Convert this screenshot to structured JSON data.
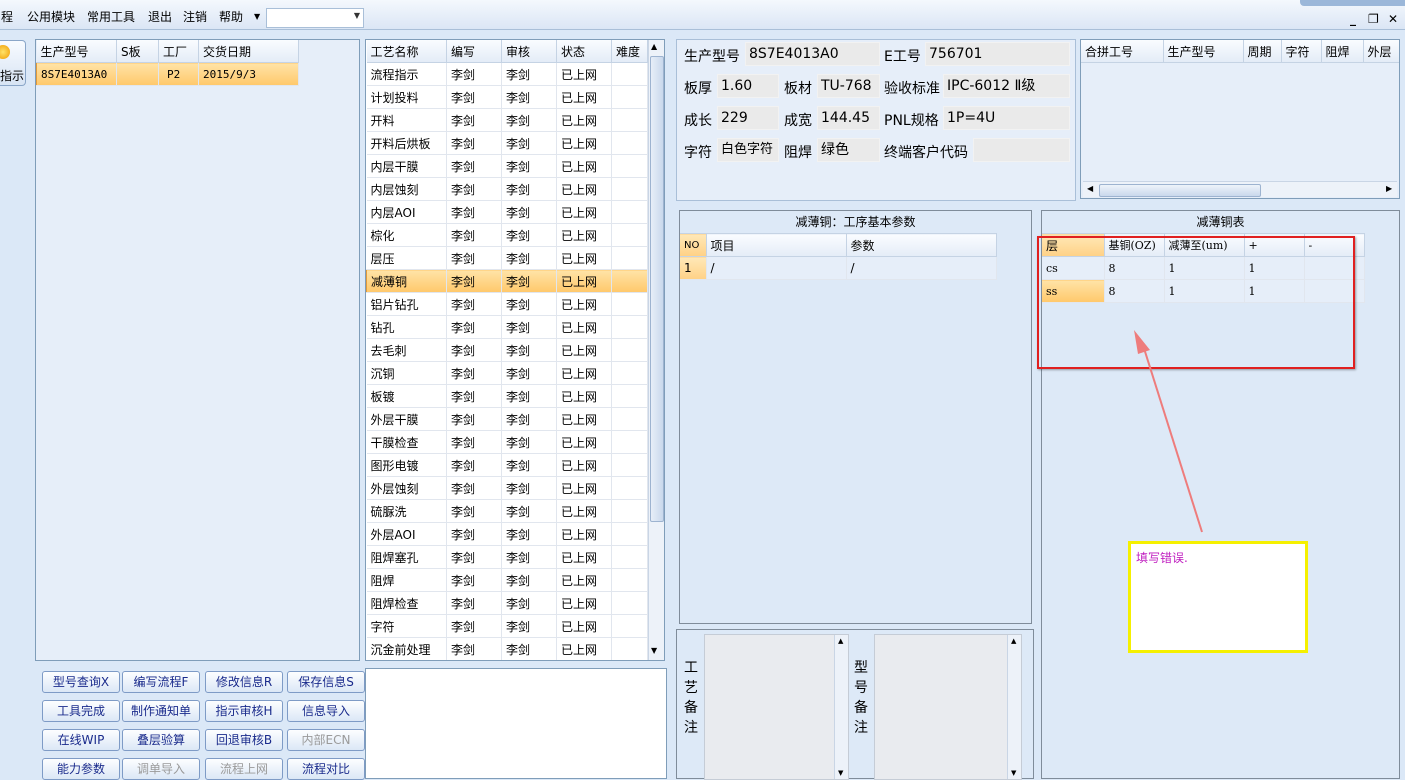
{
  "menu": {
    "items": [
      "程",
      "公用模块",
      "常用工具",
      "退出",
      "注销",
      "帮助"
    ],
    "window_controls": {
      "minimize": "_",
      "restore": "❐",
      "close": "✕"
    }
  },
  "left_icon_label": "指示",
  "model_table": {
    "headers": [
      "生产型号",
      "S板",
      "工厂",
      "交货日期"
    ],
    "rows": [
      [
        "8S7E4013A0",
        "",
        "P2",
        "2015/9/3"
      ]
    ]
  },
  "process_table": {
    "headers": [
      "工艺名称",
      "编写",
      "审核",
      "状态",
      "难度"
    ],
    "rows": [
      [
        "流程指示",
        "李剑",
        "李剑",
        "已上网",
        ""
      ],
      [
        "计划投料",
        "李剑",
        "李剑",
        "已上网",
        ""
      ],
      [
        "开料",
        "李剑",
        "李剑",
        "已上网",
        ""
      ],
      [
        "开料后烘板",
        "李剑",
        "李剑",
        "已上网",
        ""
      ],
      [
        "内层干膜",
        "李剑",
        "李剑",
        "已上网",
        ""
      ],
      [
        "内层蚀刻",
        "李剑",
        "李剑",
        "已上网",
        ""
      ],
      [
        "内层AOI",
        "李剑",
        "李剑",
        "已上网",
        ""
      ],
      [
        "棕化",
        "李剑",
        "李剑",
        "已上网",
        ""
      ],
      [
        "层压",
        "李剑",
        "李剑",
        "已上网",
        ""
      ],
      [
        "减薄铜",
        "李剑",
        "李剑",
        "已上网",
        ""
      ],
      [
        "铝片钻孔",
        "李剑",
        "李剑",
        "已上网",
        ""
      ],
      [
        "钻孔",
        "李剑",
        "李剑",
        "已上网",
        ""
      ],
      [
        "去毛刺",
        "李剑",
        "李剑",
        "已上网",
        ""
      ],
      [
        "沉铜",
        "李剑",
        "李剑",
        "已上网",
        ""
      ],
      [
        "板镀",
        "李剑",
        "李剑",
        "已上网",
        ""
      ],
      [
        "外层干膜",
        "李剑",
        "李剑",
        "已上网",
        ""
      ],
      [
        "干膜检查",
        "李剑",
        "李剑",
        "已上网",
        ""
      ],
      [
        "图形电镀",
        "李剑",
        "李剑",
        "已上网",
        ""
      ],
      [
        "外层蚀刻",
        "李剑",
        "李剑",
        "已上网",
        ""
      ],
      [
        "硫脲洗",
        "李剑",
        "李剑",
        "已上网",
        ""
      ],
      [
        "外层AOI",
        "李剑",
        "李剑",
        "已上网",
        ""
      ],
      [
        "阻焊塞孔",
        "李剑",
        "李剑",
        "已上网",
        ""
      ],
      [
        "阻焊",
        "李剑",
        "李剑",
        "已上网",
        ""
      ],
      [
        "阻焊检查",
        "李剑",
        "李剑",
        "已上网",
        ""
      ],
      [
        "字符",
        "李剑",
        "李剑",
        "已上网",
        ""
      ],
      [
        "沉金前处理",
        "李剑",
        "李剑",
        "已上网",
        ""
      ]
    ],
    "selected_index": 9
  },
  "buttons": [
    [
      "型号查询X",
      "编写流程F",
      "修改信息R",
      "保存信息S"
    ],
    [
      "工具完成",
      "制作通知单",
      "指示审核H",
      "信息导入"
    ],
    [
      "在线WIP",
      "叠层验算",
      "回退审核B",
      "内部ECN"
    ],
    [
      "能力参数",
      "调单导入",
      "流程上网",
      "流程对比"
    ]
  ],
  "disabled_buttons": [
    "内部ECN",
    "调单导入",
    "流程上网"
  ],
  "info": {
    "model_label": "生产型号",
    "model_value": "8S7E4013A0",
    "e_label": "E工号",
    "e_value": "756701",
    "thickness_label": "板厚",
    "thickness_value": "1.60",
    "material_label": "板材",
    "material_value": "TU-768",
    "accept_label": "验收标准",
    "accept_value": "IPC-6012 Ⅱ级",
    "length_label": "成长",
    "length_value": "229",
    "width_label": "成宽",
    "width_value": "144.45",
    "pnl_label": "PNL规格",
    "pnl_value": "1P=4U",
    "char_label": "字符",
    "char_value": "白色字符",
    "solder_label": "阻焊",
    "solder_value": "绿色",
    "customer_label": "终端客户代码",
    "customer_value": ""
  },
  "combine_table": {
    "headers": [
      "合拼工号",
      "生产型号",
      "周期",
      "字符",
      "阻焊",
      "外层"
    ]
  },
  "params": {
    "title": "减薄铜：工序基本参数",
    "headers": [
      "NO",
      "项目",
      "参数"
    ],
    "rows": [
      [
        "1",
        "/",
        "/"
      ]
    ]
  },
  "thin_copper": {
    "title": "减薄铜表",
    "headers": [
      "层",
      "基铜(OZ)",
      "减薄至(um)",
      "+",
      "-"
    ],
    "rows": [
      [
        "cs",
        "8",
        "1",
        "1",
        ""
      ],
      [
        "ss",
        "8",
        "1",
        "1",
        ""
      ]
    ]
  },
  "annotation": {
    "text": "填写错误."
  },
  "remarks": {
    "process_label": [
      "工",
      "艺",
      "备",
      "注"
    ],
    "model_label": [
      "型",
      "号",
      "备",
      "注"
    ]
  },
  "colors": {
    "annotation_red": "#e02020",
    "annotation_yellow": "#f5f000",
    "annotation_text": "#c020c0",
    "selected_row": "#ffc86b"
  }
}
